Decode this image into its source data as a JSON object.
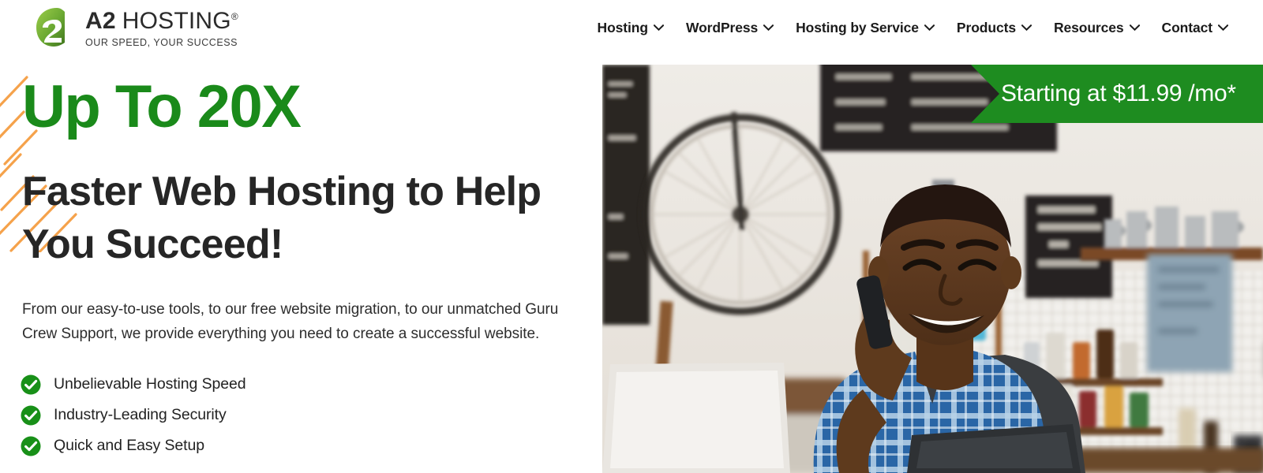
{
  "brand": {
    "logo_icon": "a2-logo-mark",
    "name_prefix": "A2",
    "name_suffix": "HOSTING",
    "registered_mark": "®",
    "tagline": "OUR SPEED, YOUR SUCCESS",
    "green": "#1a8a1a",
    "logo_green_light": "#8cc63f",
    "logo_green_dark": "#4b8b2b"
  },
  "nav": {
    "items": [
      {
        "label": "Hosting",
        "icon": "chevron-down-icon",
        "has_dropdown": true
      },
      {
        "label": "WordPress",
        "icon": "chevron-down-icon",
        "has_dropdown": true
      },
      {
        "label": "Hosting by Service",
        "icon": "chevron-down-icon",
        "has_dropdown": true
      },
      {
        "label": "Products",
        "icon": "chevron-down-icon",
        "has_dropdown": true
      },
      {
        "label": "Resources",
        "icon": "chevron-down-icon",
        "has_dropdown": true
      },
      {
        "label": "Contact",
        "icon": "chevron-down-icon",
        "has_dropdown": true
      }
    ]
  },
  "hero": {
    "headline_accent": "Up To 20X",
    "headline_main": "Faster Web Hosting to Help You Succeed!",
    "paragraph": "From our easy-to-use tools, to our free website migration, to our unmatched Guru Crew Support, we provide everything you need to create a successful website.",
    "features": [
      {
        "icon": "check-circle-icon",
        "label": "Unbelievable Hosting Speed"
      },
      {
        "icon": "check-circle-icon",
        "label": "Industry-Leading Security"
      },
      {
        "icon": "check-circle-icon",
        "label": "Quick and Easy Setup"
      }
    ],
    "accent_color": "#1a8a1a",
    "text_color": "#262626",
    "streak_color": "#f5a24b"
  },
  "price_banner": {
    "text": "Starting at $11.99 /mo*",
    "background": "#1e8c20",
    "text_color": "#ffffff"
  },
  "hero_photo": {
    "alt": "Smiling man talking on a mobile phone in a cafe kitchen",
    "scene": "cafe-counter"
  }
}
